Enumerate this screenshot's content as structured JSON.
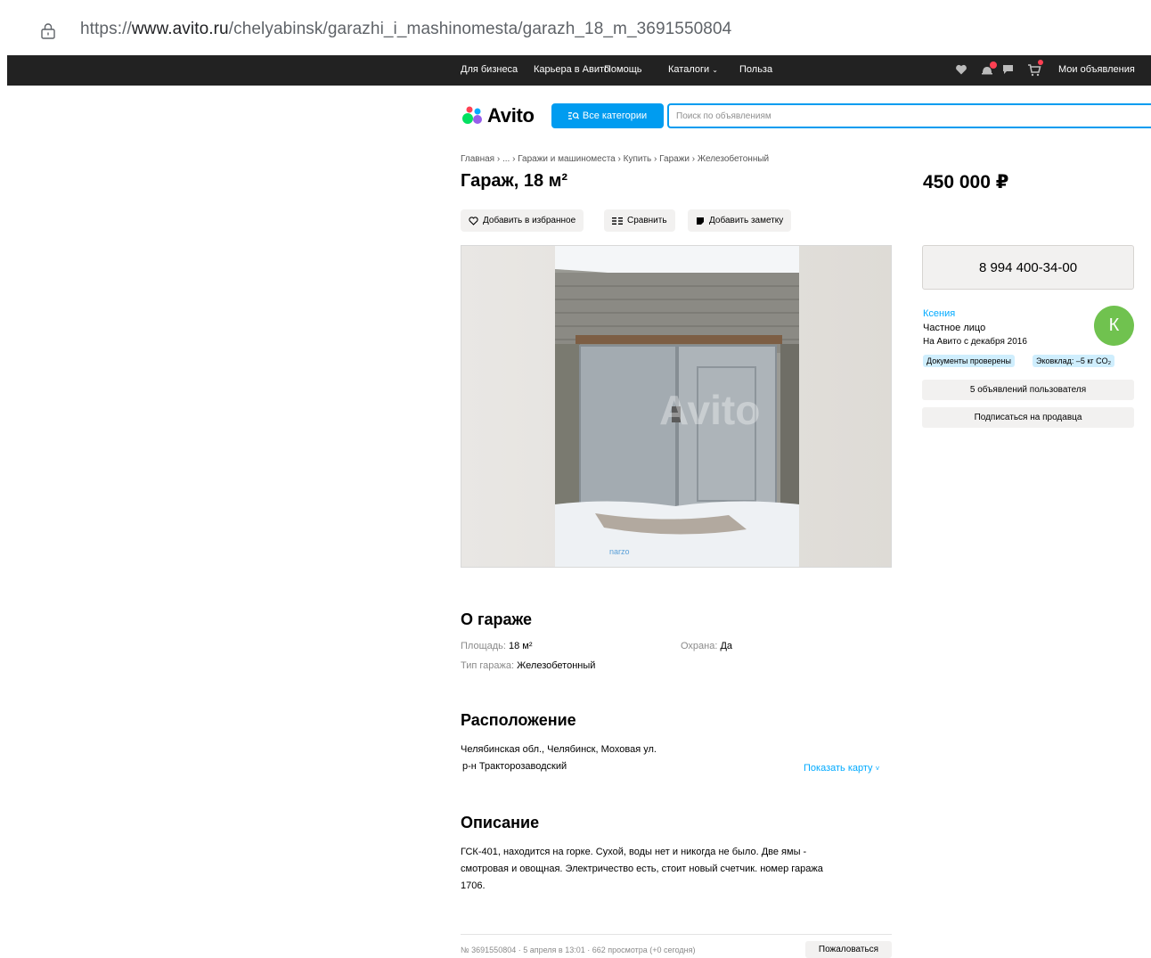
{
  "browser": {
    "url_scheme": "https://",
    "url_domain": "www.avito.ru",
    "url_path": "/chelyabinsk/garazhi_i_mashinomesta/garazh_18_m_3691550804"
  },
  "topnav": {
    "business": "Для бизнеса",
    "career": "Карьера в Авито",
    "help": "Помощь",
    "catalogs": "Каталоги",
    "benefit": "Польза",
    "my_ads": "Мои объявления"
  },
  "header": {
    "logo": "Avito",
    "categories_label": "Все категории",
    "search_placeholder": "Поиск по объявлениям"
  },
  "breadcrumb": [
    "Главная",
    "...",
    "Гаражи и машиноместа",
    "Купить",
    "Гаражи",
    "Железобетонный"
  ],
  "listing": {
    "title": "Гараж, 18 м²",
    "price": "450 000 ₽",
    "actions": {
      "favorite": "Добавить в избранное",
      "compare": "Сравнить",
      "note": "Добавить заметку"
    },
    "photo_watermark": "Avito",
    "photo_caption": "narzo"
  },
  "seller": {
    "phone": "8 994 400-34-00",
    "name": "Ксения",
    "type": "Частное лицо",
    "since": "На Авито с декабря 2016",
    "avatar_letter": "К",
    "badges": [
      "Документы проверены",
      "Эковклад: –5 кг CO₂"
    ],
    "ads_button": "5 объявлений пользователя",
    "subscribe_button": "Подписаться на продавца"
  },
  "about": {
    "heading": "О гараже",
    "area_label": "Площадь:",
    "area_value": "18 м²",
    "security_label": "Охрана:",
    "security_value": "Да",
    "type_label": "Тип гаража:",
    "type_value": "Железобетонный"
  },
  "location": {
    "heading": "Расположение",
    "address": "Челябинская обл., Челябинск, Моховая ул.",
    "district": "р-н Тракторозаводский",
    "map_link": "Показать карту"
  },
  "description": {
    "heading": "Описание",
    "line1": "ГСК-401, находится на горке. Сухой, воды нет и никогда не было. Две ямы -",
    "line2": "смотровая и овощная. Электричество есть, стоит новый счетчик. номер гаража",
    "line3": "1706."
  },
  "footer": {
    "meta": "№ 3691550804 · 5 апреля в 13:01 · 662 просмотра (+0 сегодня)",
    "report": "Пожаловаться"
  },
  "colors": {
    "accent": "#009cf0",
    "link": "#00aaff",
    "nav_bg": "#222222",
    "avatar": "#70c24f"
  }
}
